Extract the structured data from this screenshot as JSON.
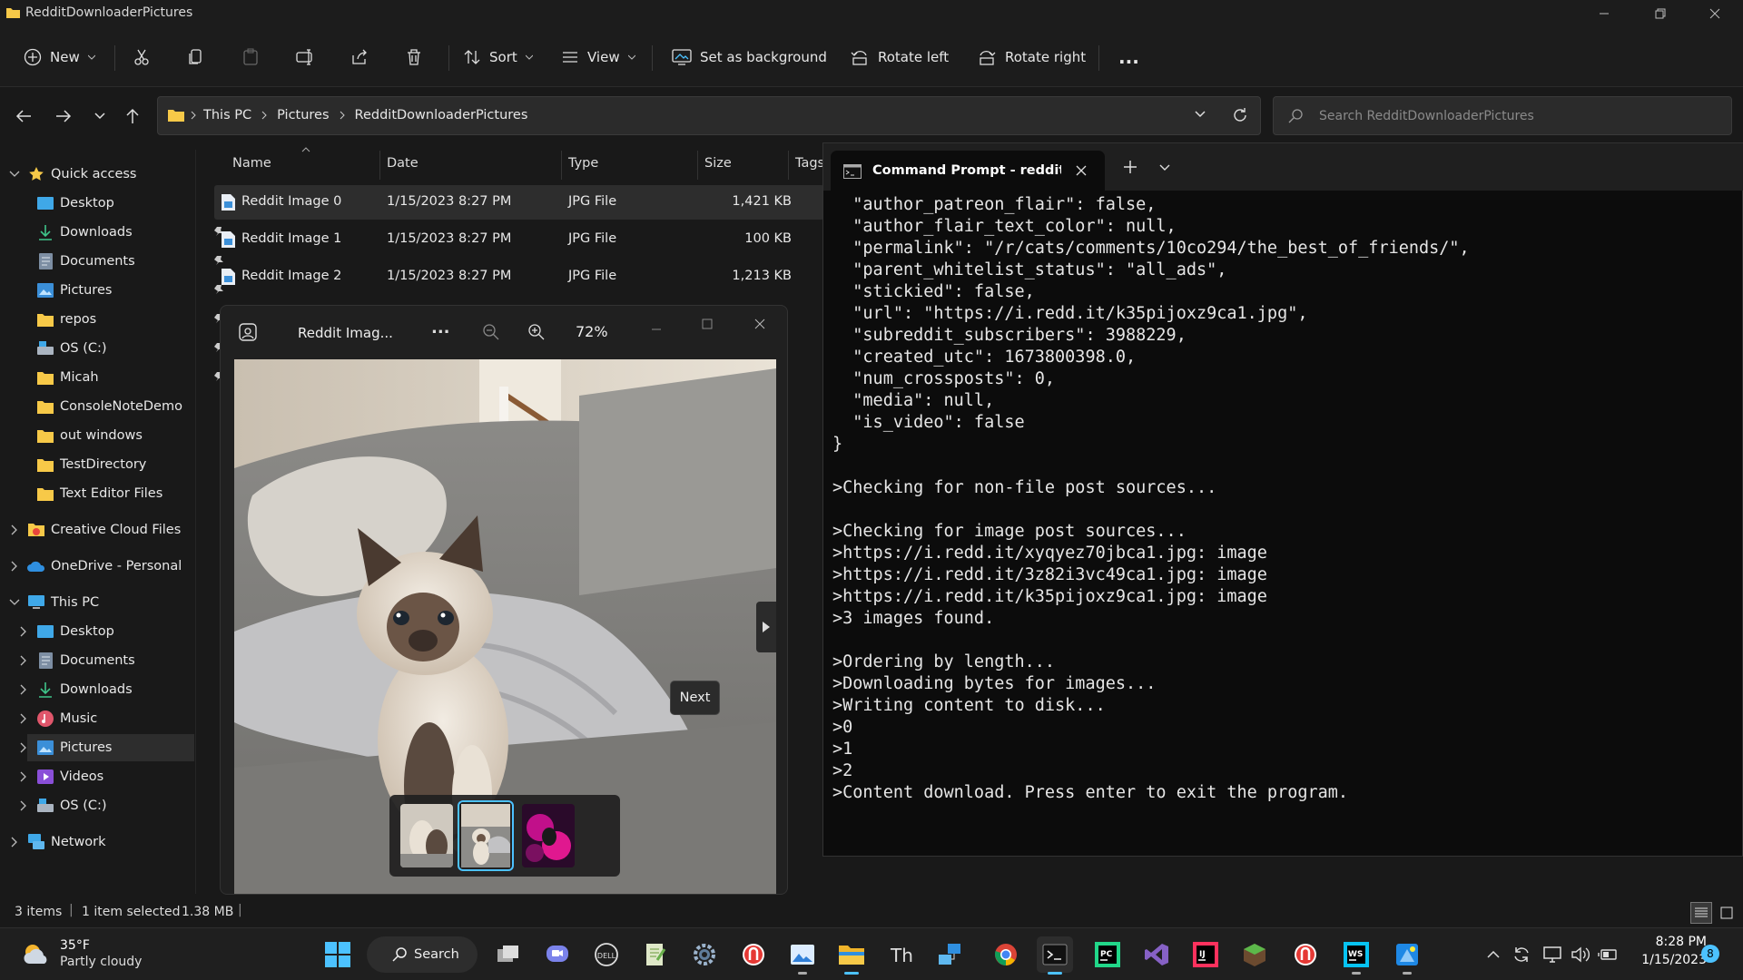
{
  "window": {
    "title": "RedditDownloaderPictures"
  },
  "toolbar": {
    "new_label": "New",
    "sort_label": "Sort",
    "view_label": "View",
    "set_background_label": "Set as background",
    "rotate_left_label": "Rotate left",
    "rotate_right_label": "Rotate right",
    "more_label": "..."
  },
  "address": {
    "crumbs": [
      "This PC",
      "Pictures",
      "RedditDownloaderPictures"
    ],
    "search_placeholder": "Search RedditDownloaderPictures"
  },
  "sidebar": {
    "quick_access": "Quick access",
    "pinned": [
      "Desktop",
      "Downloads",
      "Documents",
      "Pictures",
      "repos",
      "OS (C:)",
      "Micah"
    ],
    "recent": [
      "ConsoleNoteDemo",
      "out windows",
      "TestDirectory",
      "Text Editor Files"
    ],
    "creative_cloud": "Creative Cloud Files",
    "onedrive": "OneDrive - Personal",
    "this_pc": "This PC",
    "this_pc_items": [
      "Desktop",
      "Documents",
      "Downloads",
      "Music",
      "Pictures",
      "Videos",
      "OS (C:)"
    ],
    "network": "Network"
  },
  "files": {
    "headers": {
      "name": "Name",
      "date": "Date",
      "type": "Type",
      "size": "Size",
      "tags": "Tags"
    },
    "rows": [
      {
        "name": "Reddit Image 0",
        "date": "1/15/2023 8:27 PM",
        "type": "JPG File",
        "size": "1,421 KB"
      },
      {
        "name": "Reddit Image 1",
        "date": "1/15/2023 8:27 PM",
        "type": "JPG File",
        "size": "100 KB"
      },
      {
        "name": "Reddit Image 2",
        "date": "1/15/2023 8:27 PM",
        "type": "JPG File",
        "size": "1,213 KB"
      }
    ]
  },
  "photos": {
    "title": "Reddit Imag...",
    "more": "...",
    "zoom": "72%",
    "next_tooltip": "Next"
  },
  "terminal": {
    "tab_title": "Command Prompt - redditdov",
    "lines": [
      "  \"author_patreon_flair\": false,",
      "  \"author_flair_text_color\": null,",
      "  \"permalink\": \"/r/cats/comments/10co294/the_best_of_friends/\",",
      "  \"parent_whitelist_status\": \"all_ads\",",
      "  \"stickied\": false,",
      "  \"url\": \"https://i.redd.it/k35pijoxz9ca1.jpg\",",
      "  \"subreddit_subscribers\": 3988229,",
      "  \"created_utc\": 1673800398.0,",
      "  \"num_crossposts\": 0,",
      "  \"media\": null,",
      "  \"is_video\": false",
      "}",
      "",
      ">Checking for non-file post sources...",
      "",
      ">Checking for image post sources...",
      ">https://i.redd.it/xyqyez70jbca1.jpg: image",
      ">https://i.redd.it/3z82i3vc49ca1.jpg: image",
      ">https://i.redd.it/k35pijoxz9ca1.jpg: image",
      ">3 images found.",
      "",
      ">Ordering by length...",
      ">Downloading bytes for images...",
      ">Writing content to disk...",
      ">0",
      ">1",
      ">2",
      ">Content download. Press enter to exit the program."
    ]
  },
  "status": {
    "items": "3 items",
    "selected": "1 item selected",
    "size": "1.38 MB"
  },
  "taskbar": {
    "temp": "35°F",
    "weather": "Partly cloudy",
    "search": "Search",
    "time": "8:28 PM",
    "date": "1/15/2023",
    "notif_count": "8"
  },
  "colors": {
    "accent": "#4cc2ff",
    "folder": "#f7c948",
    "terminal_bg": "#0c0c0c"
  }
}
